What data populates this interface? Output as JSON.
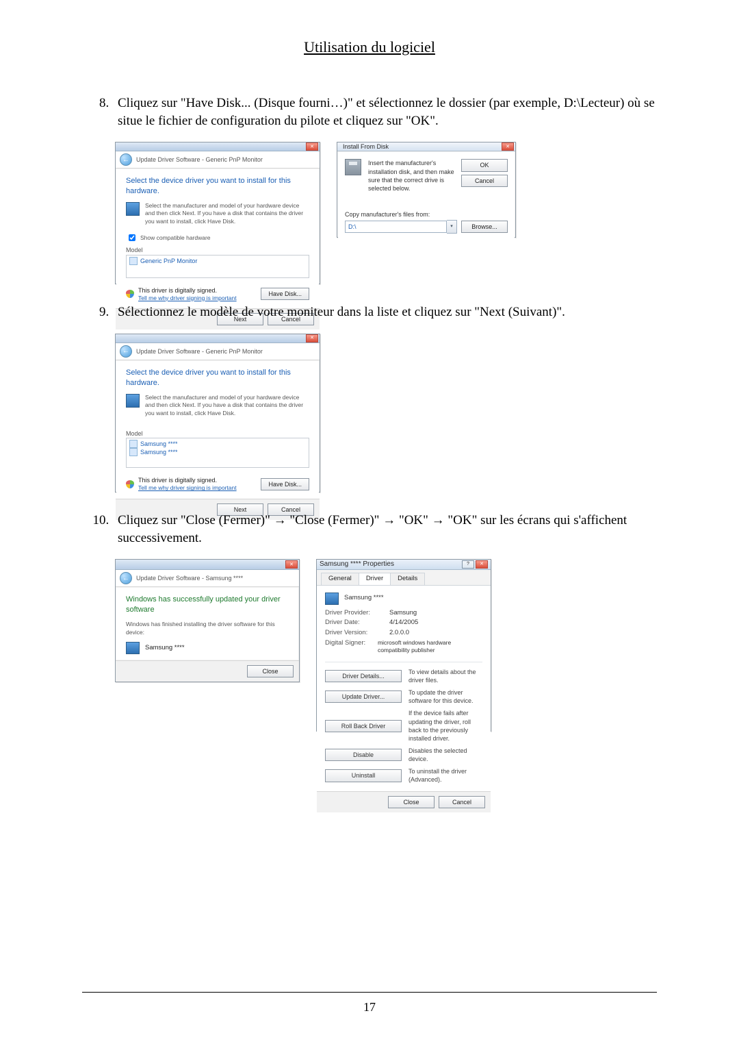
{
  "sectionTitle": "Utilisation du logiciel",
  "pageNumber": "17",
  "steps": {
    "s8": {
      "num": "8.",
      "text": "Cliquez sur \"Have Disk... (Disque fourni…)\" et sélectionnez le dossier (par exemple, D:\\Lecteur) où se situe le fichier de configuration du pilote et cliquez sur \"OK\"."
    },
    "s9": {
      "num": "9.",
      "text": "Sélectionnez le modèle de votre moniteur dans la liste et cliquez sur \"Next (Suivant)\"."
    },
    "s10": {
      "num": "10.",
      "text": "Cliquez sur \"Close (Fermer)\" → \"Close (Fermer)\" → \"OK\" → \"OK\" sur les écrans qui s'affichent successivement."
    }
  },
  "dialogs": {
    "wiz1": {
      "headerPath": "Update Driver Software - Generic PnP Monitor",
      "instruction": "Select the device driver you want to install for this hardware.",
      "hint": "Select the manufacturer and model of your hardware device and then click Next. If you have a disk that contains the driver you want to install, click Have Disk.",
      "showCompat": "Show compatible hardware",
      "modelLabel": "Model",
      "modelItem": "Generic PnP Monitor",
      "signed": "This driver is digitally signed.",
      "signedLink": "Tell me why driver signing is important",
      "haveDisk": "Have Disk...",
      "next": "Next",
      "cancel": "Cancel"
    },
    "ifd": {
      "title": "Install From Disk",
      "msg": "Insert the manufacturer's installation disk, and then make sure that the correct drive is selected below.",
      "ok": "OK",
      "cancel": "Cancel",
      "copyLabel": "Copy manufacturer's files from:",
      "path": "D:\\",
      "browse": "Browse..."
    },
    "wiz2": {
      "headerPath": "Update Driver Software - Generic PnP Monitor",
      "instruction": "Select the device driver you want to install for this hardware.",
      "hint": "Select the manufacturer and model of your hardware device and then click Next. If you have a disk that contains the driver you want to install, click Have Disk.",
      "modelLabel": "Model",
      "modelItem1": "Samsung ****",
      "modelItem2": "Samsung ****",
      "signed": "This driver is digitally signed.",
      "signedLink": "Tell me why driver signing is important",
      "haveDisk": "Have Disk...",
      "next": "Next",
      "cancel": "Cancel"
    },
    "wiz3": {
      "headerPath": "Update Driver Software - Samsung ****",
      "success": "Windows has successfully updated your driver software",
      "finished": "Windows has finished installing the driver software for this device:",
      "device": "Samsung ****",
      "close": "Close"
    },
    "props": {
      "title": "Samsung **** Properties",
      "tabGeneral": "General",
      "tabDriver": "Driver",
      "tabDetails": "Details",
      "device": "Samsung ****",
      "providerLabel": "Driver Provider:",
      "provider": "Samsung",
      "dateLabel": "Driver Date:",
      "date": "4/14/2005",
      "versionLabel": "Driver Version:",
      "version": "2.0.0.0",
      "signerLabel": "Digital Signer:",
      "signer": "microsoft windows hardware compatibility publisher",
      "btnDetails": "Driver Details...",
      "descDetails": "To view details about the driver files.",
      "btnUpdate": "Update Driver...",
      "descUpdate": "To update the driver software for this device.",
      "btnRoll": "Roll Back Driver",
      "descRoll": "If the device fails after updating the driver, roll back to the previously installed driver.",
      "btnDisable": "Disable",
      "descDisable": "Disables the selected device.",
      "btnUninstall": "Uninstall",
      "descUninstall": "To uninstall the driver (Advanced).",
      "close": "Close",
      "cancel": "Cancel"
    }
  }
}
